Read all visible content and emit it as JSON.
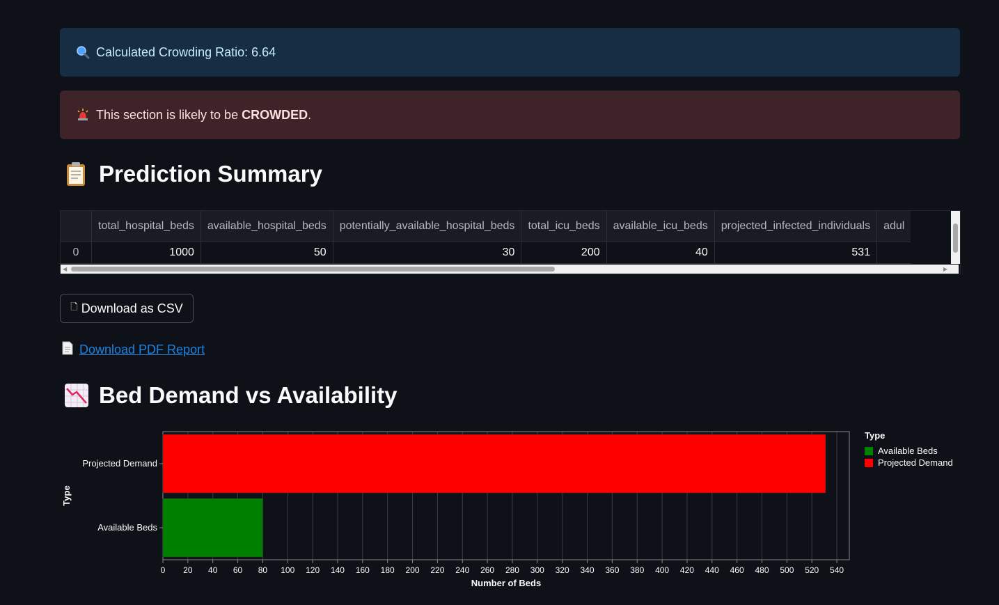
{
  "alerts": {
    "info_text": "Calculated Crowding Ratio: 6.64",
    "error_prefix": "This section is likely to be ",
    "error_strong": "CROWDED",
    "error_suffix": "."
  },
  "summary": {
    "heading": "Prediction Summary",
    "columns": [
      "",
      "total_hospital_beds",
      "available_hospital_beds",
      "potentially_available_hospital_beds",
      "total_icu_beds",
      "available_icu_beds",
      "projected_infected_individuals",
      "adul"
    ],
    "row": [
      "0",
      "1000",
      "50",
      "30",
      "200",
      "40",
      "531",
      ""
    ]
  },
  "download_csv_label": "Download as CSV",
  "download_pdf_label": "Download PDF Report",
  "chart_heading": "Bed Demand vs Availability",
  "chart_data": {
    "type": "bar",
    "orientation": "horizontal",
    "categories": [
      "Projected Demand",
      "Available Beds"
    ],
    "values": [
      531,
      80
    ],
    "colors": [
      "#ff0000",
      "#008000"
    ],
    "xlabel": "Number of Beds",
    "ylabel": "Type",
    "xlim": [
      0,
      550
    ],
    "xticks": [
      0,
      20,
      40,
      60,
      80,
      100,
      120,
      140,
      160,
      180,
      200,
      220,
      240,
      260,
      280,
      300,
      320,
      340,
      360,
      380,
      400,
      420,
      440,
      460,
      480,
      500,
      520,
      540
    ],
    "grid": true,
    "legend": {
      "title": "Type",
      "placement": "right",
      "entries": [
        {
          "label": "Available Beds",
          "color": "#008000"
        },
        {
          "label": "Projected Demand",
          "color": "#ff0000"
        }
      ]
    }
  }
}
